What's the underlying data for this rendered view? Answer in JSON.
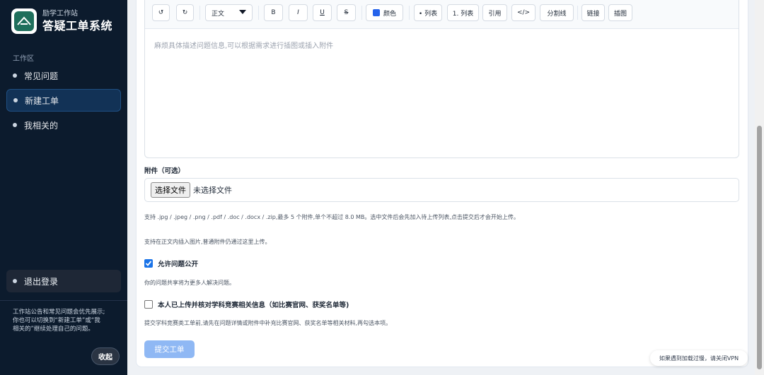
{
  "brand": {
    "subtitle": "励学工作站",
    "title": "答疑工单系统"
  },
  "sidebar": {
    "section_label": "工作区",
    "items": [
      {
        "label": "常见问题",
        "active": false
      },
      {
        "label": "新建工单",
        "active": true
      },
      {
        "label": "我相关的",
        "active": false
      }
    ],
    "logout_label": "退出登录",
    "notice_lines": [
      "工作站公告和常见问题会优先展示;",
      "你也可以切换到“新建工单”或“我",
      "相关的”继续处理自己的问题。"
    ],
    "collapse_label": "收起"
  },
  "editor": {
    "toolbar": {
      "undo_icon": "↺",
      "redo_icon": "↻",
      "format_select": "正文",
      "bold": "B",
      "italic": "I",
      "underline": "U",
      "strike": "S",
      "color": "颜色",
      "bullet_list": "• 列表",
      "ordered_list": "1. 列表",
      "quote": "引用",
      "code": "</>",
      "divider": "分割线",
      "link": "链接",
      "image": "插图"
    },
    "placeholder": "麻烦具体描述问题信息,可以根据需求进行插图或插入附件"
  },
  "attachment": {
    "label": "附件（可选）",
    "choose_button": "选择文件",
    "status": "未选择文件",
    "hint1": "支持 .jpg / .jpeg / .png / .pdf / .doc / .docx / .zip,最多 5 个附件,单个不超过 8.0 MB。选中文件后会先加入待上传列表,点击提交后才会开始上传。",
    "hint2": "支持在正文内插入图片,普通附件仍通过这里上传。"
  },
  "public_option": {
    "label": "允许问题公开",
    "checked": true,
    "hint": "你的问题共享将为更多人解决问题。"
  },
  "competition_option": {
    "label": "本人已上传并核对学科竞赛相关信息（如比赛官网、获奖名单等)",
    "checked": false,
    "hint": "提交学科竞赛类工单前,请先在问题详情或附件中补充比赛官网、获奖名单等相关材料,再勾选本项。"
  },
  "submit_label": "提交工单",
  "toast": "如果遇到加载过慢，请关闭VPN",
  "colors": {
    "sidebar_bg": "#0c1b2d",
    "accent": "#1a73e8",
    "submit_disabled": "#8fb8f4"
  }
}
